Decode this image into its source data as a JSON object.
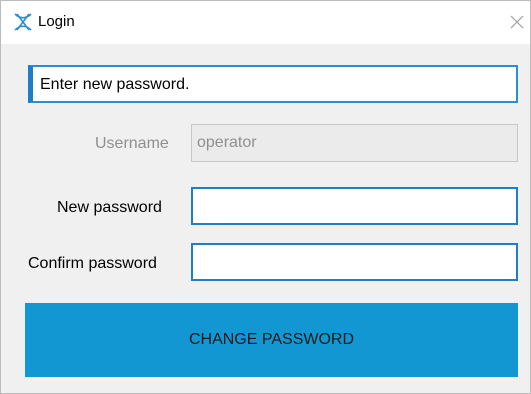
{
  "window": {
    "title": "Login",
    "icon": "app-logo-icon",
    "close_icon": "close-icon"
  },
  "message": {
    "text": "Enter new password."
  },
  "form": {
    "username": {
      "label": "Username",
      "value": "operator",
      "disabled": true
    },
    "new_password": {
      "label": "New password",
      "value": ""
    },
    "confirm_password": {
      "label": "Confirm password",
      "value": ""
    }
  },
  "actions": {
    "change_password_label": "CHANGE PASSWORD"
  },
  "colors": {
    "accent": "#1297d3",
    "field_border": "#1f7fc6",
    "background": "#f0f0f0"
  }
}
